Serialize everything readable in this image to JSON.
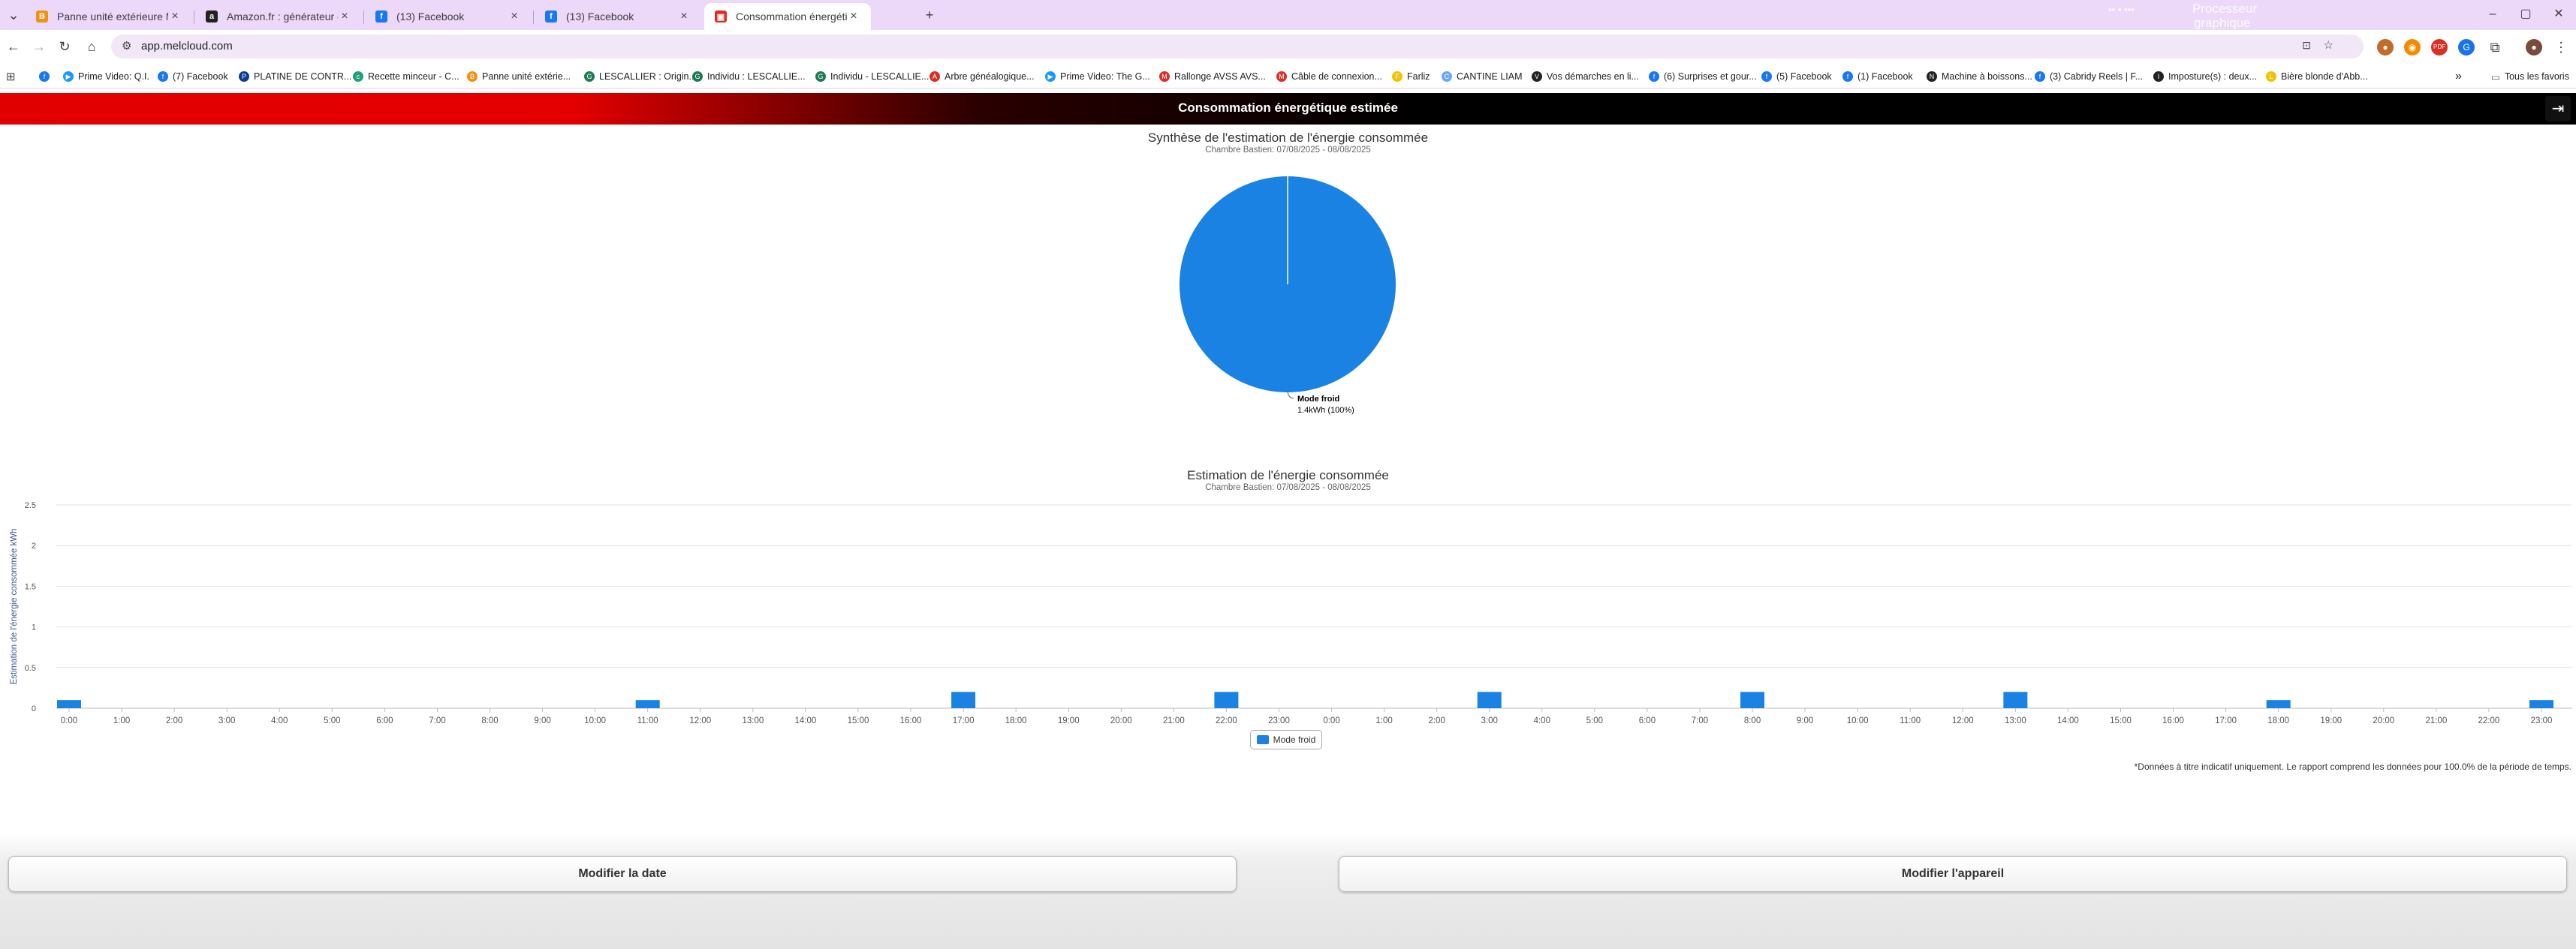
{
  "browser": {
    "tabs": [
      {
        "label": "Panne unité extérieure Mitsubi...",
        "fav": "B",
        "fav_color": "#f29111"
      },
      {
        "label": "Amazon.fr : générateur de temp...",
        "fav": "a",
        "fav_color": "#222222"
      },
      {
        "label": "(13) Facebook",
        "fav": "f",
        "fav_color": "#1877f2"
      },
      {
        "label": "(13) Facebook",
        "fav": "f",
        "fav_color": "#1877f2"
      },
      {
        "label": "Consommation énergétique es...",
        "fav": "▣",
        "fav_color": "#d93025"
      }
    ],
    "new_tab": "+",
    "overlay_texts": [
      "Processeur",
      "graphique"
    ],
    "url": "app.melcloud.com",
    "bookmarks": [
      {
        "label": "",
        "color": "#1877f2",
        "glyph": "f"
      },
      {
        "label": "Prime Video: Q.I.",
        "color": "#1a98ff",
        "glyph": "▶"
      },
      {
        "label": "(7) Facebook",
        "color": "#1877f2",
        "glyph": "f"
      },
      {
        "label": "PLATINE DE CONTR...",
        "color": "#0a3d91",
        "glyph": "P"
      },
      {
        "label": "Recette minceur - C...",
        "color": "#21a179",
        "glyph": "c"
      },
      {
        "label": "Panne unité extérie...",
        "color": "#f29111",
        "glyph": "B"
      },
      {
        "label": "LESCALLIER : Origin...",
        "color": "#1e7b56",
        "glyph": "G"
      },
      {
        "label": "Individu : LESCALLIE...",
        "color": "#1e7b56",
        "glyph": "G"
      },
      {
        "label": "Individu - LESCALLIE...",
        "color": "#1e7b56",
        "glyph": "G"
      },
      {
        "label": "Arbre généalogique...",
        "color": "#d93025",
        "glyph": "A"
      },
      {
        "label": "Prime Video: The G...",
        "color": "#1a98ff",
        "glyph": "▶"
      },
      {
        "label": "Rallonge AVSS AVS...",
        "color": "#d93025",
        "glyph": "M"
      },
      {
        "label": "Câble de connexion...",
        "color": "#d93025",
        "glyph": "M"
      },
      {
        "label": "Farliz",
        "color": "#f2c200",
        "glyph": "F"
      },
      {
        "label": "CANTINE LIAM",
        "color": "#6aa9f5",
        "glyph": "C"
      },
      {
        "label": "Vos démarches en li...",
        "color": "#222222",
        "glyph": "V"
      },
      {
        "label": "(6) Surprises et gour...",
        "color": "#1877f2",
        "glyph": "f"
      },
      {
        "label": "(5) Facebook",
        "color": "#1877f2",
        "glyph": "f"
      },
      {
        "label": "(1) Facebook",
        "color": "#1877f2",
        "glyph": "f"
      },
      {
        "label": "Machine à boissons...",
        "color": "#222222",
        "glyph": "N"
      },
      {
        "label": "(3) Cabridy Reels | F...",
        "color": "#1877f2",
        "glyph": "f"
      },
      {
        "label": "Imposture(s) : deux...",
        "color": "#222222",
        "glyph": "I"
      },
      {
        "label": "Bière blonde d'Abb...",
        "color": "#f2c200",
        "glyph": "L"
      }
    ],
    "more_bookmarks": "»",
    "all_bookmarks": "Tous les favoris"
  },
  "app": {
    "header_title": "Consommation énergétique estimée",
    "pie_title": "Synthèse de l'estimation de l'énergie consommée",
    "pie_subtitle": "Chambre Bastien: 07/08/2025 - 08/08/2025",
    "pie_label_name": "Mode froid",
    "pie_label_value": "1.4kWh (100%)",
    "bar_title": "Estimation de l'énergie consommée",
    "bar_subtitle": "Chambre Bastien: 07/08/2025 - 08/08/2025",
    "legend_label": "Mode froid",
    "disclaimer": "*Données à titre indicatif uniquement. Le rapport comprend les données pour 100.0% de la période de temps.",
    "button_date": "Modifier la date",
    "button_device": "Modifier l'appareil",
    "accent_color": "#1a82e2"
  },
  "chart_data": [
    {
      "type": "pie",
      "title": "Synthèse de l'estimation de l'énergie consommée",
      "subtitle": "Chambre Bastien: 07/08/2025 - 08/08/2025",
      "slices": [
        {
          "name": "Mode froid",
          "value": 1.4,
          "percent": 100
        }
      ]
    },
    {
      "type": "bar",
      "title": "Estimation de l'énergie consommée",
      "subtitle": "Chambre Bastien: 07/08/2025 - 08/08/2025",
      "ylabel": "Estimation de l'énergie consommée kWh",
      "ylim": [
        0,
        2.5
      ],
      "yticks": [
        "0",
        "0.5",
        "1",
        "1.5",
        "2",
        "2.5"
      ],
      "categories": [
        "0:00",
        "1:00",
        "2:00",
        "3:00",
        "4:00",
        "5:00",
        "6:00",
        "7:00",
        "8:00",
        "9:00",
        "10:00",
        "11:00",
        "12:00",
        "13:00",
        "14:00",
        "15:00",
        "16:00",
        "17:00",
        "18:00",
        "19:00",
        "20:00",
        "21:00",
        "22:00",
        "23:00",
        "0:00",
        "1:00",
        "2:00",
        "3:00",
        "4:00",
        "5:00",
        "6:00",
        "7:00",
        "8:00",
        "9:00",
        "10:00",
        "11:00",
        "12:00",
        "13:00",
        "14:00",
        "15:00",
        "16:00",
        "17:00",
        "18:00",
        "19:00",
        "20:00",
        "21:00",
        "22:00",
        "23:00"
      ],
      "series": [
        {
          "name": "Mode froid",
          "values": [
            0.1,
            0,
            0,
            0,
            0,
            0,
            0,
            0,
            0,
            0,
            0,
            0.1,
            0,
            0,
            0,
            0,
            0,
            0.2,
            0,
            0,
            0,
            0,
            0.2,
            0,
            0,
            0,
            0,
            0.2,
            0,
            0,
            0,
            0,
            0.2,
            0,
            0,
            0,
            0,
            0.2,
            0,
            0,
            0,
            0,
            0.1,
            0,
            0,
            0,
            0,
            0.1
          ]
        }
      ],
      "grid": true,
      "legend": "bottom"
    }
  ]
}
